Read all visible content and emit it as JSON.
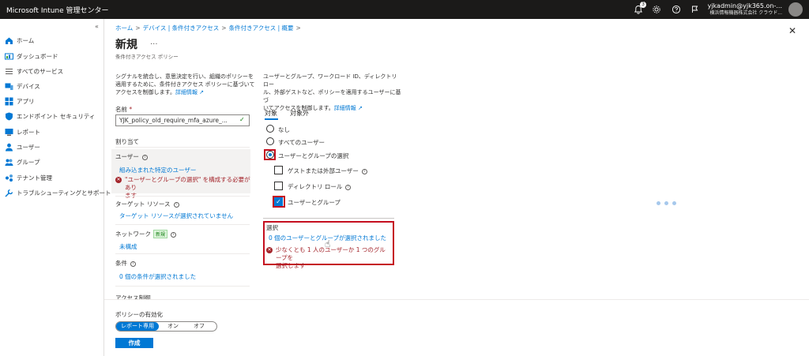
{
  "topbar": {
    "brand": "Microsoft Intune 管理センター",
    "notification_count": "3",
    "account_email": "yjkadmin@yjk365.on-...",
    "account_org": "横浜情報機器株式会社 クラウド..."
  },
  "nav": {
    "collapse": "«",
    "items": [
      {
        "label": "ホーム",
        "icon": "home-icon"
      },
      {
        "label": "ダッシュボード",
        "icon": "dashboard-icon"
      },
      {
        "label": "すべてのサービス",
        "icon": "list-icon"
      },
      {
        "label": "デバイス",
        "icon": "devices-icon"
      },
      {
        "label": "アプリ",
        "icon": "apps-icon"
      },
      {
        "label": "エンドポイント セキュリティ",
        "icon": "shield-icon"
      },
      {
        "label": "レポート",
        "icon": "reports-icon"
      },
      {
        "label": "ユーザー",
        "icon": "user-icon"
      },
      {
        "label": "グループ",
        "icon": "groups-icon"
      },
      {
        "label": "テナント管理",
        "icon": "tenant-icon"
      },
      {
        "label": "トラブルシューティングとサポート",
        "icon": "wrench-icon"
      }
    ]
  },
  "breadcrumb": [
    "ホーム",
    "デバイス | 条件付きアクセス",
    "条件付きアクセス | 概要"
  ],
  "page": {
    "title": "新規",
    "more": "...",
    "subtitle": "条件付きアクセス ポリシー",
    "close": "✕"
  },
  "left": {
    "desc_line1": "シグナルを統合し、意思決定を行い、組織のポリシーを",
    "desc_line2": "適用するために、条件付きアクセス ポリシーに基づいて",
    "desc_line3": "アクセスを制御します。",
    "desc_link": "詳細情報",
    "name_label": "名前",
    "name_required": "*",
    "name_value": "YJK_policy_old_require_mfa_azure_...",
    "assignments_label": "割り当て",
    "users_label": "ユーザー",
    "users_value": "組み込まれた特定のユーザー",
    "users_error_line1": "\"ユーザーとグループの選択\" を構成する必要があり",
    "users_error_line2": "ます",
    "target_label": "ターゲット リソース",
    "target_value": "ターゲット リソースが選択されていません",
    "network_label": "ネットワーク",
    "network_badge": "新規",
    "network_value": "未構成",
    "conditions_label": "条件",
    "conditions_value": "0 個の条件が選択されました",
    "access_control_label": "アクセス制御"
  },
  "right": {
    "desc_line1": "ユーザーとグループ、ワークロード ID、ディレクトリ ロー",
    "desc_line2": "ル、外部ゲストなど、ポリシーを適用するユーザーに基づ",
    "desc_line3": "いてアクセスを制御します。",
    "desc_link": "詳細情報",
    "tabs": [
      "対象",
      "対象外"
    ],
    "radios": [
      {
        "label": "なし",
        "checked": false
      },
      {
        "label": "すべてのユーザー",
        "checked": false
      },
      {
        "label": "ユーザーとグループの選択",
        "checked": true
      }
    ],
    "checkboxes": [
      {
        "label": "ゲストまたは外部ユーザー",
        "checked": false
      },
      {
        "label": "ディレクトリ ロール",
        "checked": false
      },
      {
        "label": "ユーザーとグループ",
        "checked": true
      }
    ],
    "select_label": "選択",
    "select_value": "0 個のユーザーとグループが選択されました",
    "select_error_line1": "少なくとも 1 人のユーザーか 1 つのグループを",
    "select_error_line2": "選択します"
  },
  "footer": {
    "enable_label": "ポリシーの有効化",
    "options": [
      "レポート専用",
      "オン",
      "オフ"
    ],
    "selected": "レポート専用",
    "create": "作成"
  },
  "colors": {
    "accent": "#0078d4",
    "error": "#a4262c",
    "highlight": "#c50f1f",
    "topbar": "#1b1a19"
  }
}
